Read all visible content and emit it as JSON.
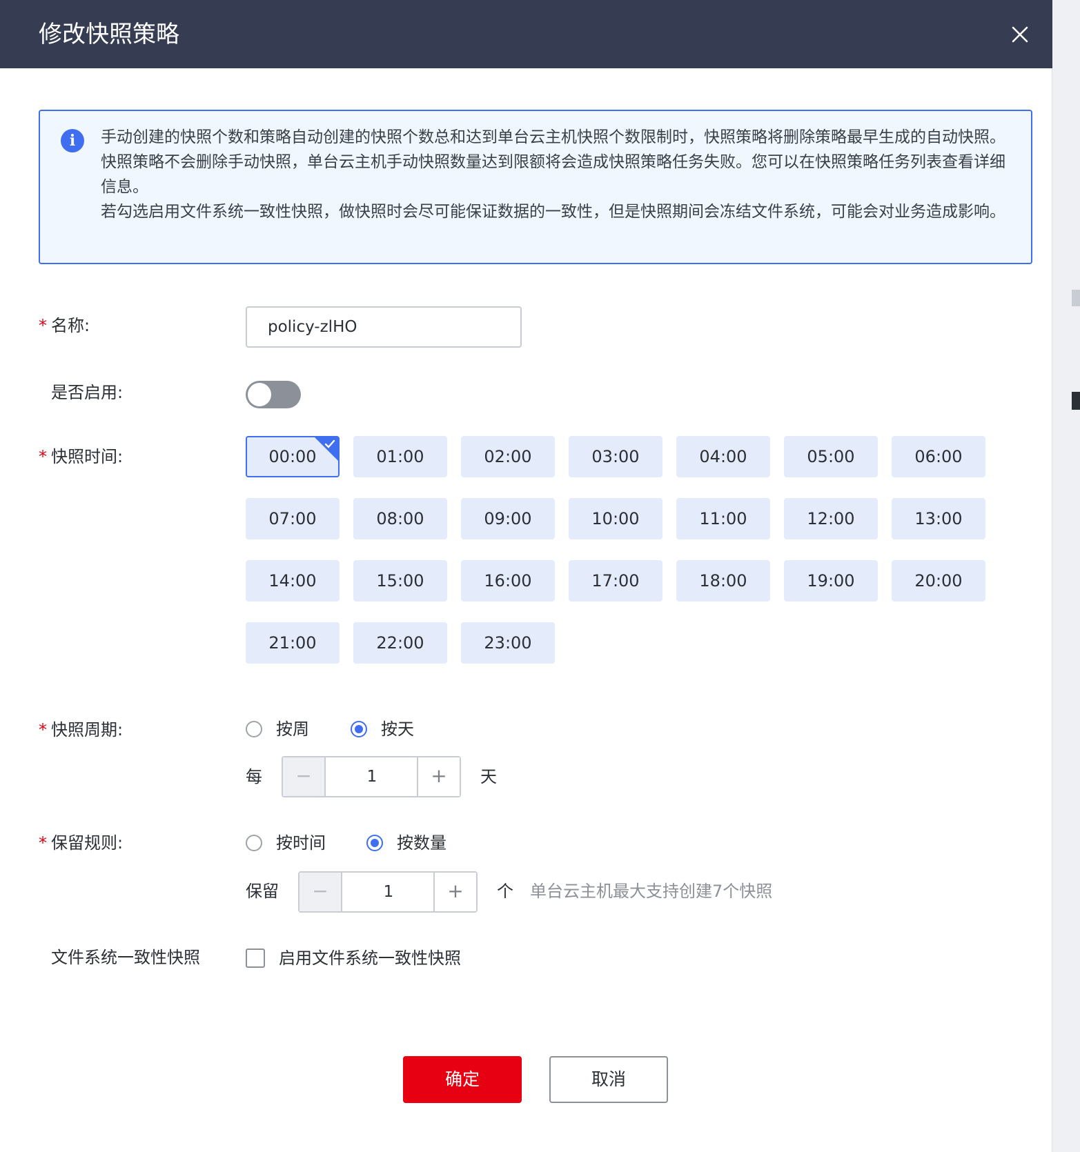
{
  "dialog": {
    "title": "修改快照策略",
    "close_icon": "close-icon"
  },
  "info": {
    "icon": "info-icon",
    "line1": "手动创建的快照个数和策略自动创建的快照个数总和达到单台云主机快照个数限制时，快照策略将删除策略最早生成的自动快照。快照策略不会删除手动快照，单台云主机手动快照数量达到限额将会造成快照策略任务失败。您可以在快照策略任务列表查看详细信息。",
    "line2": "若勾选启用文件系统一致性快照，做快照时会尽可能保证数据的一致性，但是快照期间会冻结文件系统，可能会对业务造成影响。"
  },
  "form": {
    "required_mark": "*",
    "name": {
      "label": "名称:",
      "value": "policy-zlHO"
    },
    "enabled": {
      "label": "是否启用:",
      "on": false
    },
    "times": {
      "label": "快照时间:",
      "selected": "00:00",
      "options": [
        "00:00",
        "01:00",
        "02:00",
        "03:00",
        "04:00",
        "05:00",
        "06:00",
        "07:00",
        "08:00",
        "09:00",
        "10:00",
        "11:00",
        "12:00",
        "13:00",
        "14:00",
        "15:00",
        "16:00",
        "17:00",
        "18:00",
        "19:00",
        "20:00",
        "21:00",
        "22:00",
        "23:00"
      ]
    },
    "cycle": {
      "label": "快照周期:",
      "options": [
        "按周",
        "按天"
      ],
      "selected": "按天",
      "prefix": "每",
      "value": "1",
      "suffix": "天",
      "minus": "−",
      "plus": "+"
    },
    "retention": {
      "label": "保留规则:",
      "options": [
        "按时间",
        "按数量"
      ],
      "selected": "按数量",
      "prefix": "保留",
      "value": "1",
      "suffix": "个",
      "minus": "−",
      "plus": "+",
      "hint": "单台云主机最大支持创建7个快照"
    },
    "fs_consistency": {
      "label": "文件系统一致性快照",
      "checkbox_label": "启用文件系统一致性快照",
      "checked": false
    }
  },
  "footer": {
    "confirm": "确定",
    "cancel": "取消"
  },
  "colors": {
    "header_bg": "#363d52",
    "accent": "#3f6ef0",
    "confirm": "#e60012",
    "chip_bg": "#e4ebfa",
    "info_bg": "#f1f7ff"
  }
}
